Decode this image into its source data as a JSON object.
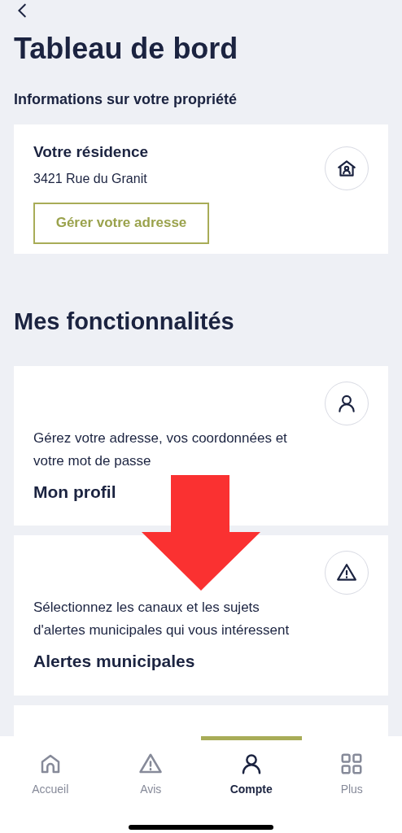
{
  "header": {
    "title": "Tableau de bord"
  },
  "property": {
    "heading": "Informations sur votre propriété",
    "title": "Votre résidence",
    "address": "3421 Rue du Granit",
    "button": "Gérer votre adresse"
  },
  "features": {
    "heading": "Mes fonctionnalités",
    "items": [
      {
        "kind": "profile",
        "description": "Gérez votre adresse, vos coordonnées et votre mot de passe",
        "title": "Mon profil"
      },
      {
        "kind": "alert",
        "description": "Sélectionnez les canaux et les sujets d'alertes municipales qui vous intéressent",
        "title": "Alertes municipales"
      }
    ]
  },
  "tab_bar": [
    {
      "kind": "home",
      "label": "Accueil",
      "selected": false
    },
    {
      "kind": "alert",
      "label": "Avis",
      "selected": false
    },
    {
      "kind": "profile",
      "label": "Compte",
      "selected": true
    },
    {
      "kind": "grid",
      "label": "Plus",
      "selected": false
    }
  ]
}
